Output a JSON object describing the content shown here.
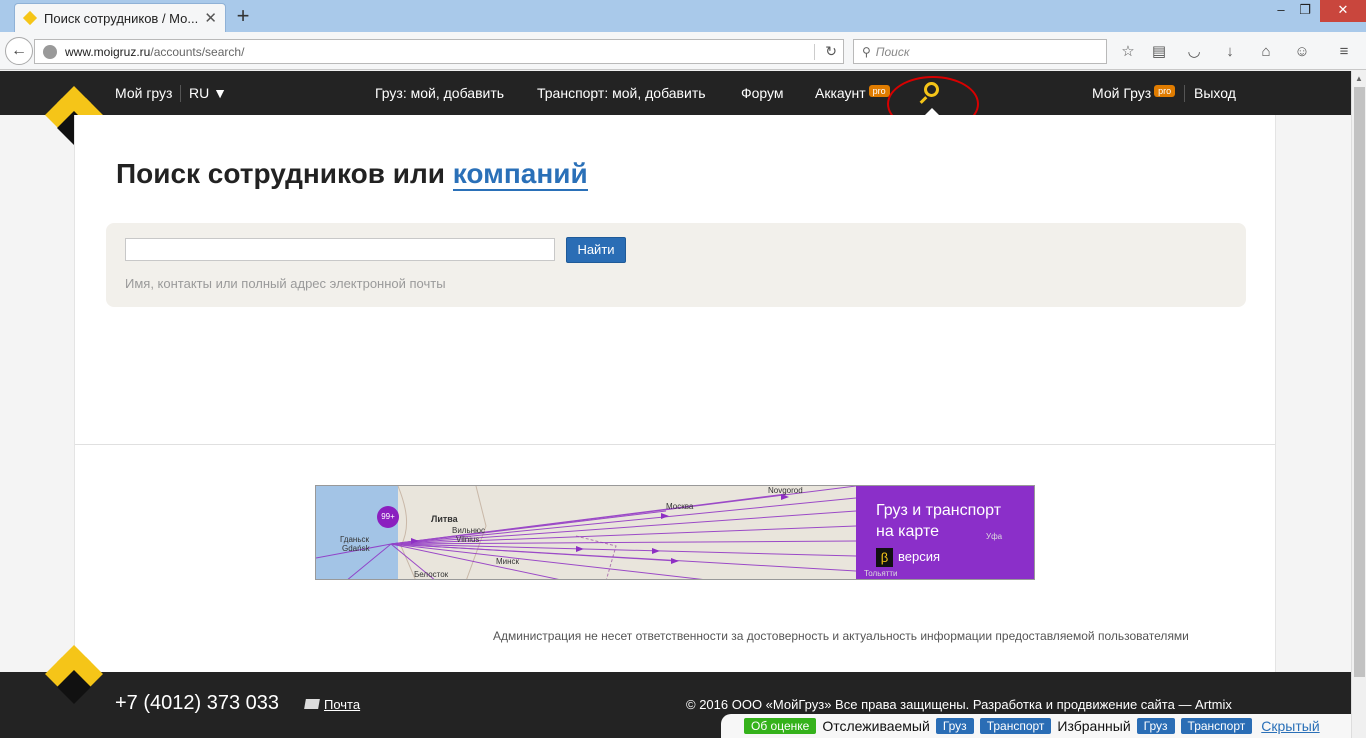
{
  "browser": {
    "tab_title": "Поиск сотрудников / Мо...",
    "new_tab": "+",
    "url_host": "www.moigruz.ru",
    "url_path": "/accounts/search/",
    "search_placeholder": "Поиск",
    "window_controls": {
      "minimize": "–",
      "maximize": "❐",
      "close": "✕"
    }
  },
  "header": {
    "my_cargo": "Мой груз",
    "lang": "RU ▼",
    "nav": [
      {
        "label": "Груз: мой, добавить"
      },
      {
        "label": "Транспорт: мой, добавить"
      },
      {
        "label": "Форум"
      },
      {
        "label": "Аккаунт",
        "badge": "pro"
      }
    ],
    "right_account": "Мой Груз",
    "right_badge": "pro",
    "logout": "Выход"
  },
  "main": {
    "title_prefix": "Поиск сотрудников или",
    "title_link": "компаний",
    "search_value": "",
    "search_button": "Найти",
    "search_hint": "Имя, контакты или полный адрес электронной почты"
  },
  "banner": {
    "promo_title_line1": "Груз и транспорт",
    "promo_title_line2": "на карте",
    "beta_glyph": "β",
    "beta_label": "версия",
    "pin_label": "99+",
    "map_labels": [
      "Литва",
      "Москва",
      "Novgorod",
      "Вильнюс",
      "Vilnius",
      "Минск",
      "Белосток",
      "Гданьск",
      "Gdańsk",
      "Уфа",
      "Тольятти"
    ]
  },
  "disclaimer": "Администрация не несет ответственности за достоверность и актуальность информации предоставляемой пользователями",
  "footer": {
    "phone": "+7 (4012) 373 033",
    "mail": "Почта",
    "copyright": "© 2016 ООО «МойГруз» Все права защищены. Разработка и продвижение сайта — Artmix"
  },
  "bottom_bar": {
    "rating": "Об оценке",
    "tracked_label": "Отслеживаемый",
    "tracked_cargo": "Груз",
    "tracked_transport": "Транспорт",
    "favorites_label": "Избранный",
    "fav_cargo": "Груз",
    "fav_transport": "Транспорт",
    "hidden": "Скрытый"
  },
  "colors": {
    "brand_yellow": "#f5c518",
    "header_bg": "#232323",
    "link_blue": "#2a70b8",
    "button_blue": "#2a6db5",
    "pro_orange": "#e07c00",
    "promo_purple": "#8b2fc9",
    "annotation_red": "#d80000"
  }
}
